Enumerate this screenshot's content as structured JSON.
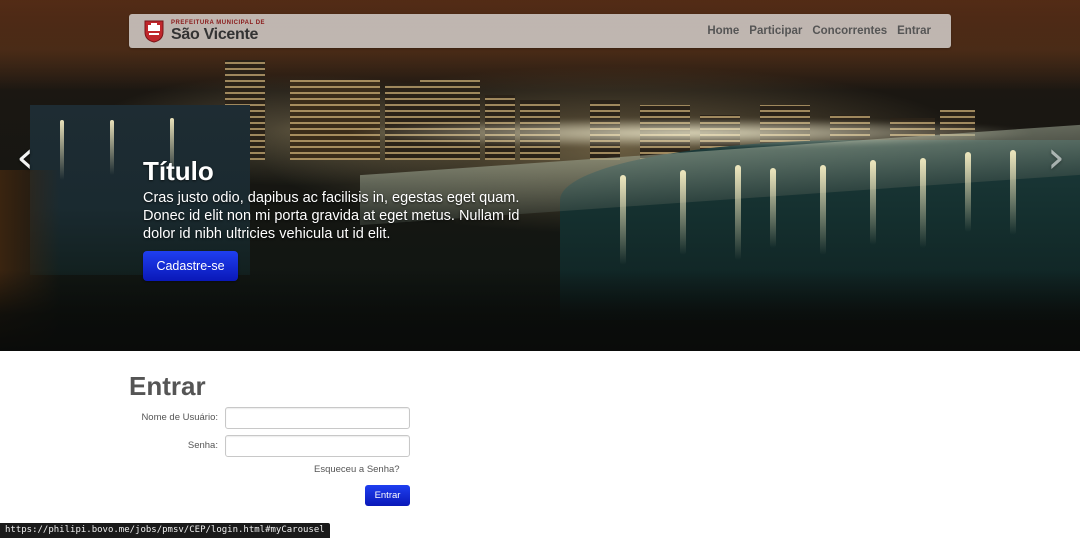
{
  "navbar": {
    "logo": {
      "small_text": "Prefeitura Municipal de",
      "big_text": "São Vicente"
    },
    "links": [
      {
        "label": "Home"
      },
      {
        "label": "Participar"
      },
      {
        "label": "Concorrentes"
      },
      {
        "label": "Entrar"
      }
    ]
  },
  "carousel": {
    "title": "Título",
    "text": "Cras justo odio, dapibus ac facilisis in, egestas eget quam. Donec id elit non mi porta gravida at eget metus. Nullam id dolor id nibh ultricies vehicula ut id elit.",
    "button_label": "Cadastre-se",
    "prev_icon": "‹",
    "next_icon": "›"
  },
  "login": {
    "heading": "Entrar",
    "username_label": "Nome de Usuário:",
    "username_value": "",
    "password_label": "Senha:",
    "password_value": "",
    "forgot_label": "Esqueceu a Senha?",
    "submit_label": "Entrar"
  },
  "statusbar": {
    "url": "https://philipi.bovo.me/jobs/pmsv/CEP/login.html#myCarousel"
  },
  "colors": {
    "primary_button": "#0a18b8",
    "navbar_bg": "#ebebeb",
    "heading_text": "#555555"
  }
}
